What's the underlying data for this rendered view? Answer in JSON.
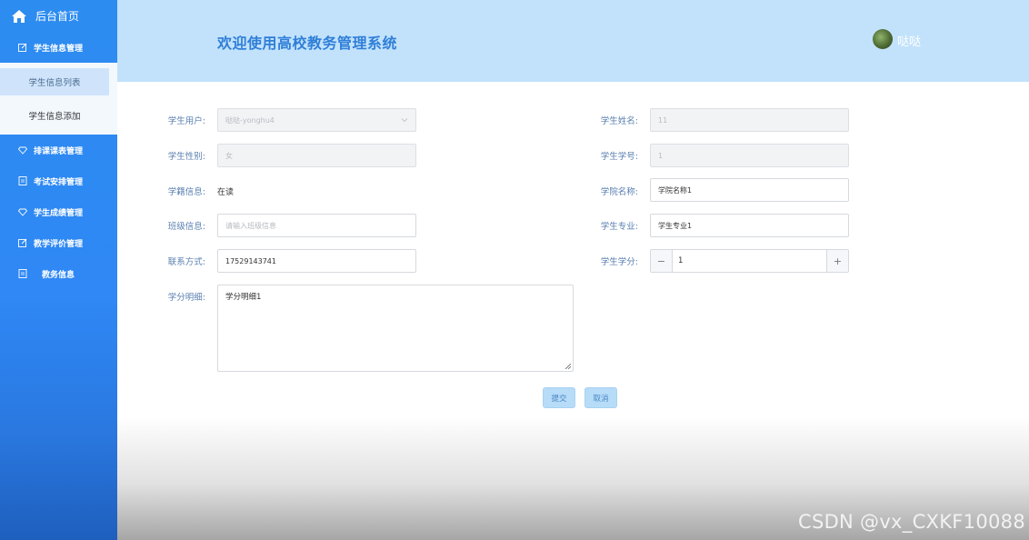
{
  "sidebar": {
    "home": "后台首页",
    "groups": [
      {
        "label": "学生信息管理",
        "icon": "edit-icon"
      },
      {
        "label": "排课课表管理",
        "icon": "diamond-icon"
      },
      {
        "label": "考试安排管理",
        "icon": "file-icon"
      },
      {
        "label": "学生成绩管理",
        "icon": "diamond-icon"
      },
      {
        "label": "教学评价管理",
        "icon": "edit-icon"
      },
      {
        "label": "教务信息",
        "icon": "file-icon"
      }
    ],
    "subitems": [
      {
        "label": "学生信息列表",
        "active": true
      },
      {
        "label": "学生信息添加",
        "active": false
      }
    ]
  },
  "header": {
    "title": "欢迎使用高校教务管理系统",
    "username": "哒哒"
  },
  "form": {
    "student_user": {
      "label": "学生用户:",
      "value": "哒哒-yonghu4"
    },
    "student_gender": {
      "label": "学生性别:",
      "value": "女"
    },
    "enrollment": {
      "label": "学籍信息:",
      "value": "在读"
    },
    "class_info": {
      "label": "班级信息:",
      "placeholder": "请输入班级信息"
    },
    "contact": {
      "label": "联系方式:",
      "value": "17529143741"
    },
    "credit_detail": {
      "label": "学分明细:",
      "value": "学分明细1"
    },
    "student_name": {
      "label": "学生姓名:",
      "value": "11"
    },
    "student_id": {
      "label": "学生学号:",
      "value": "1"
    },
    "college": {
      "label": "学院名称:",
      "value": "学院名称1"
    },
    "major": {
      "label": "学生专业:",
      "value": "学生专业1"
    },
    "credits": {
      "label": "学生学分:",
      "value": "1",
      "minus": "−",
      "plus": "+"
    }
  },
  "actions": {
    "submit": "提交",
    "cancel": "取消"
  },
  "watermark": "CSDN @vx_CXKF10088",
  "colors": {
    "accent": "#2d8cf0",
    "header_bg": "#c2e2fb",
    "title": "#2f7fd8"
  }
}
